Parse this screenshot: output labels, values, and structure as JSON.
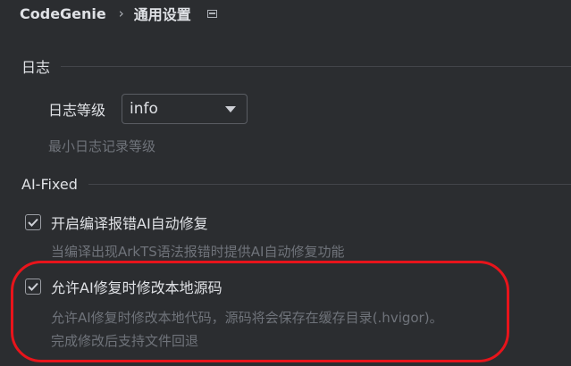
{
  "breadcrumb": {
    "root": "CodeGenie",
    "separator": "›",
    "current": "通用设置"
  },
  "log_section": {
    "title": "日志",
    "level_label": "日志等级",
    "level_value": "info",
    "level_hint": "最小日志记录等级"
  },
  "ai_fixed_section": {
    "title": "AI-Fixed",
    "options": [
      {
        "label": "开启编译报错AI自动修复",
        "checked": true,
        "hint_lines": [
          "当编译出现ArkTS语法报错时提供AI自动修复功能"
        ]
      },
      {
        "label": "允许AI修复时修改本地源码",
        "checked": true,
        "hint_lines": [
          "允许AI修复时修改本地代码，源码将会保存在缓存目录(.hvigor)。",
          "完成修改后支持文件回退"
        ]
      }
    ]
  },
  "colors": {
    "background": "#2b2d30",
    "text": "#dfe1e5",
    "hint": "#6f737a",
    "annotation": "#e8141b"
  }
}
